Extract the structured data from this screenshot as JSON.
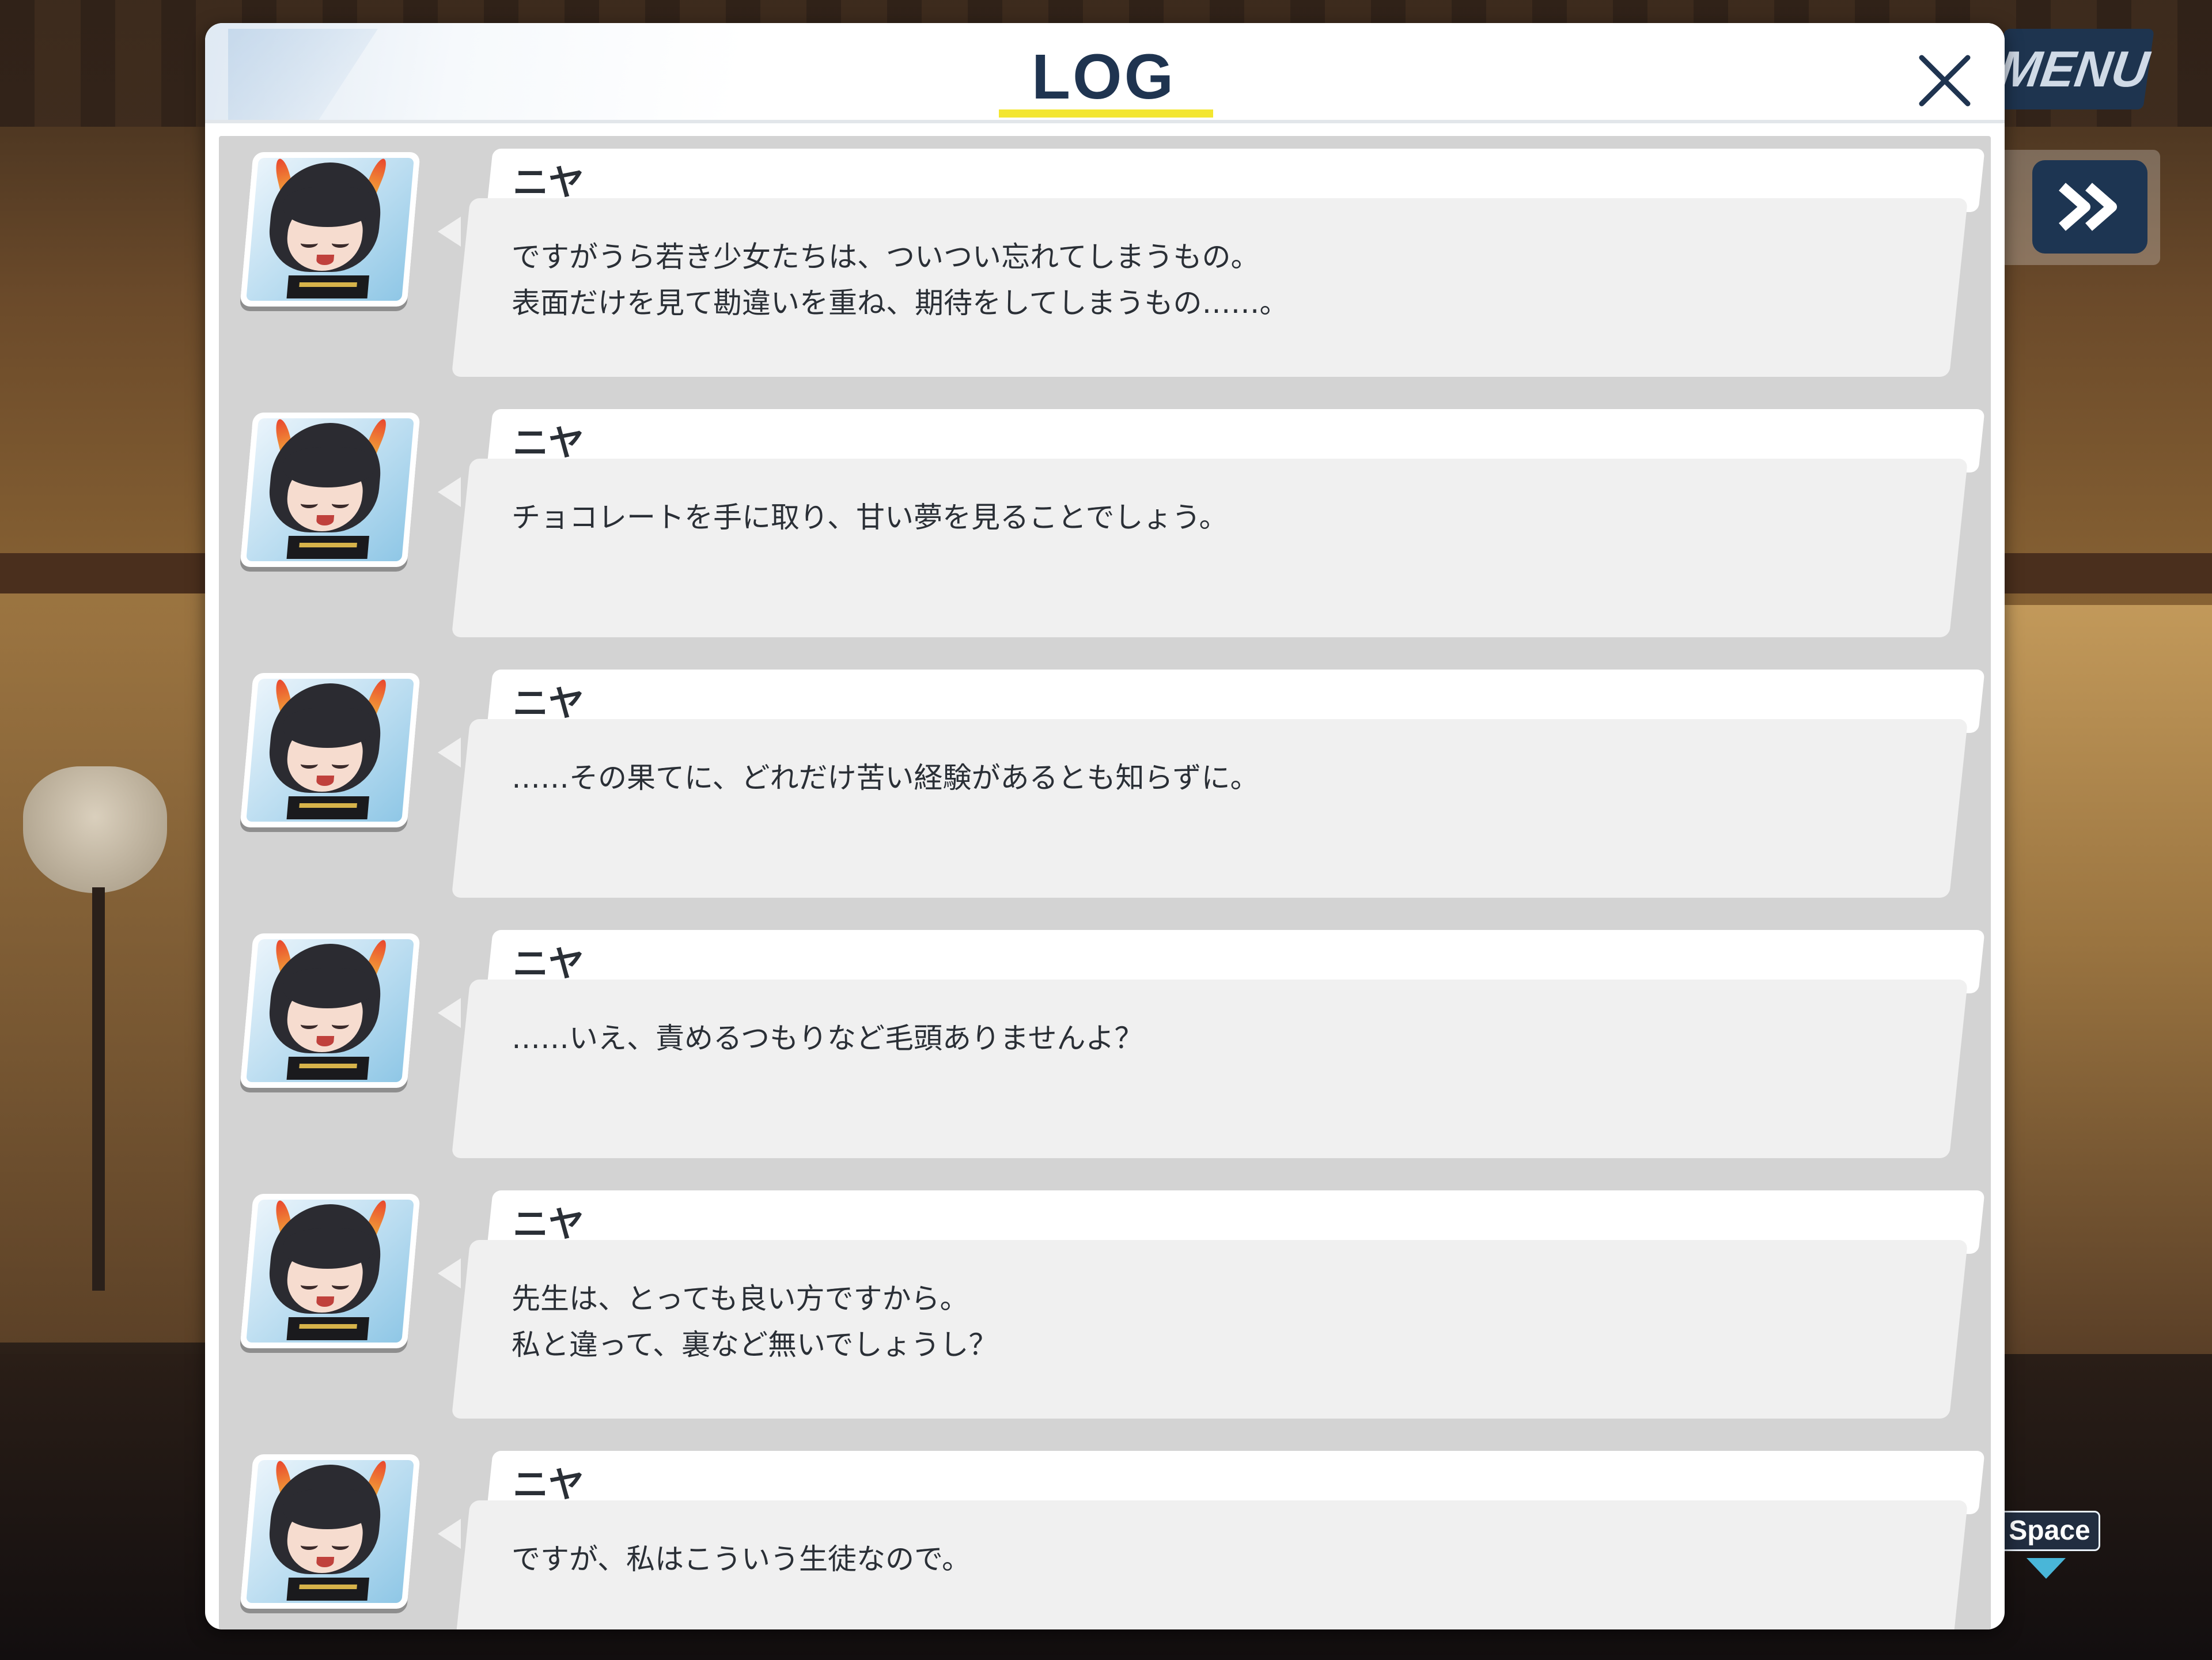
{
  "window": {
    "title": "LOG"
  },
  "controls": {
    "menu_label": "MENU",
    "space_label": "Space",
    "skip_icon": "fast-forward-icon",
    "close_icon": "close-icon"
  },
  "colors": {
    "accent_underline": "#f3e630",
    "button_navy": "#1d3552",
    "title_text": "#1f3450"
  },
  "log": {
    "entries": [
      {
        "speaker": "ニヤ",
        "text": "ですがうら若き少女たちは、ついつい忘れてしまうもの。\n表面だけを見て勘違いを重ね、期待をしてしまうもの……。"
      },
      {
        "speaker": "ニヤ",
        "text": "チョコレートを手に取り、甘い夢を見ることでしょう。"
      },
      {
        "speaker": "ニヤ",
        "text": "……その果てに、どれだけ苦い経験があるとも知らずに。"
      },
      {
        "speaker": "ニヤ",
        "text": "……いえ、責めるつもりなど毛頭ありませんよ？"
      },
      {
        "speaker": "ニヤ",
        "text": "先生は、とっても良い方ですから。\n私と違って、裏など無いでしょうし？"
      },
      {
        "speaker": "ニヤ",
        "text": "ですが、私はこういう生徒なので。"
      }
    ]
  }
}
